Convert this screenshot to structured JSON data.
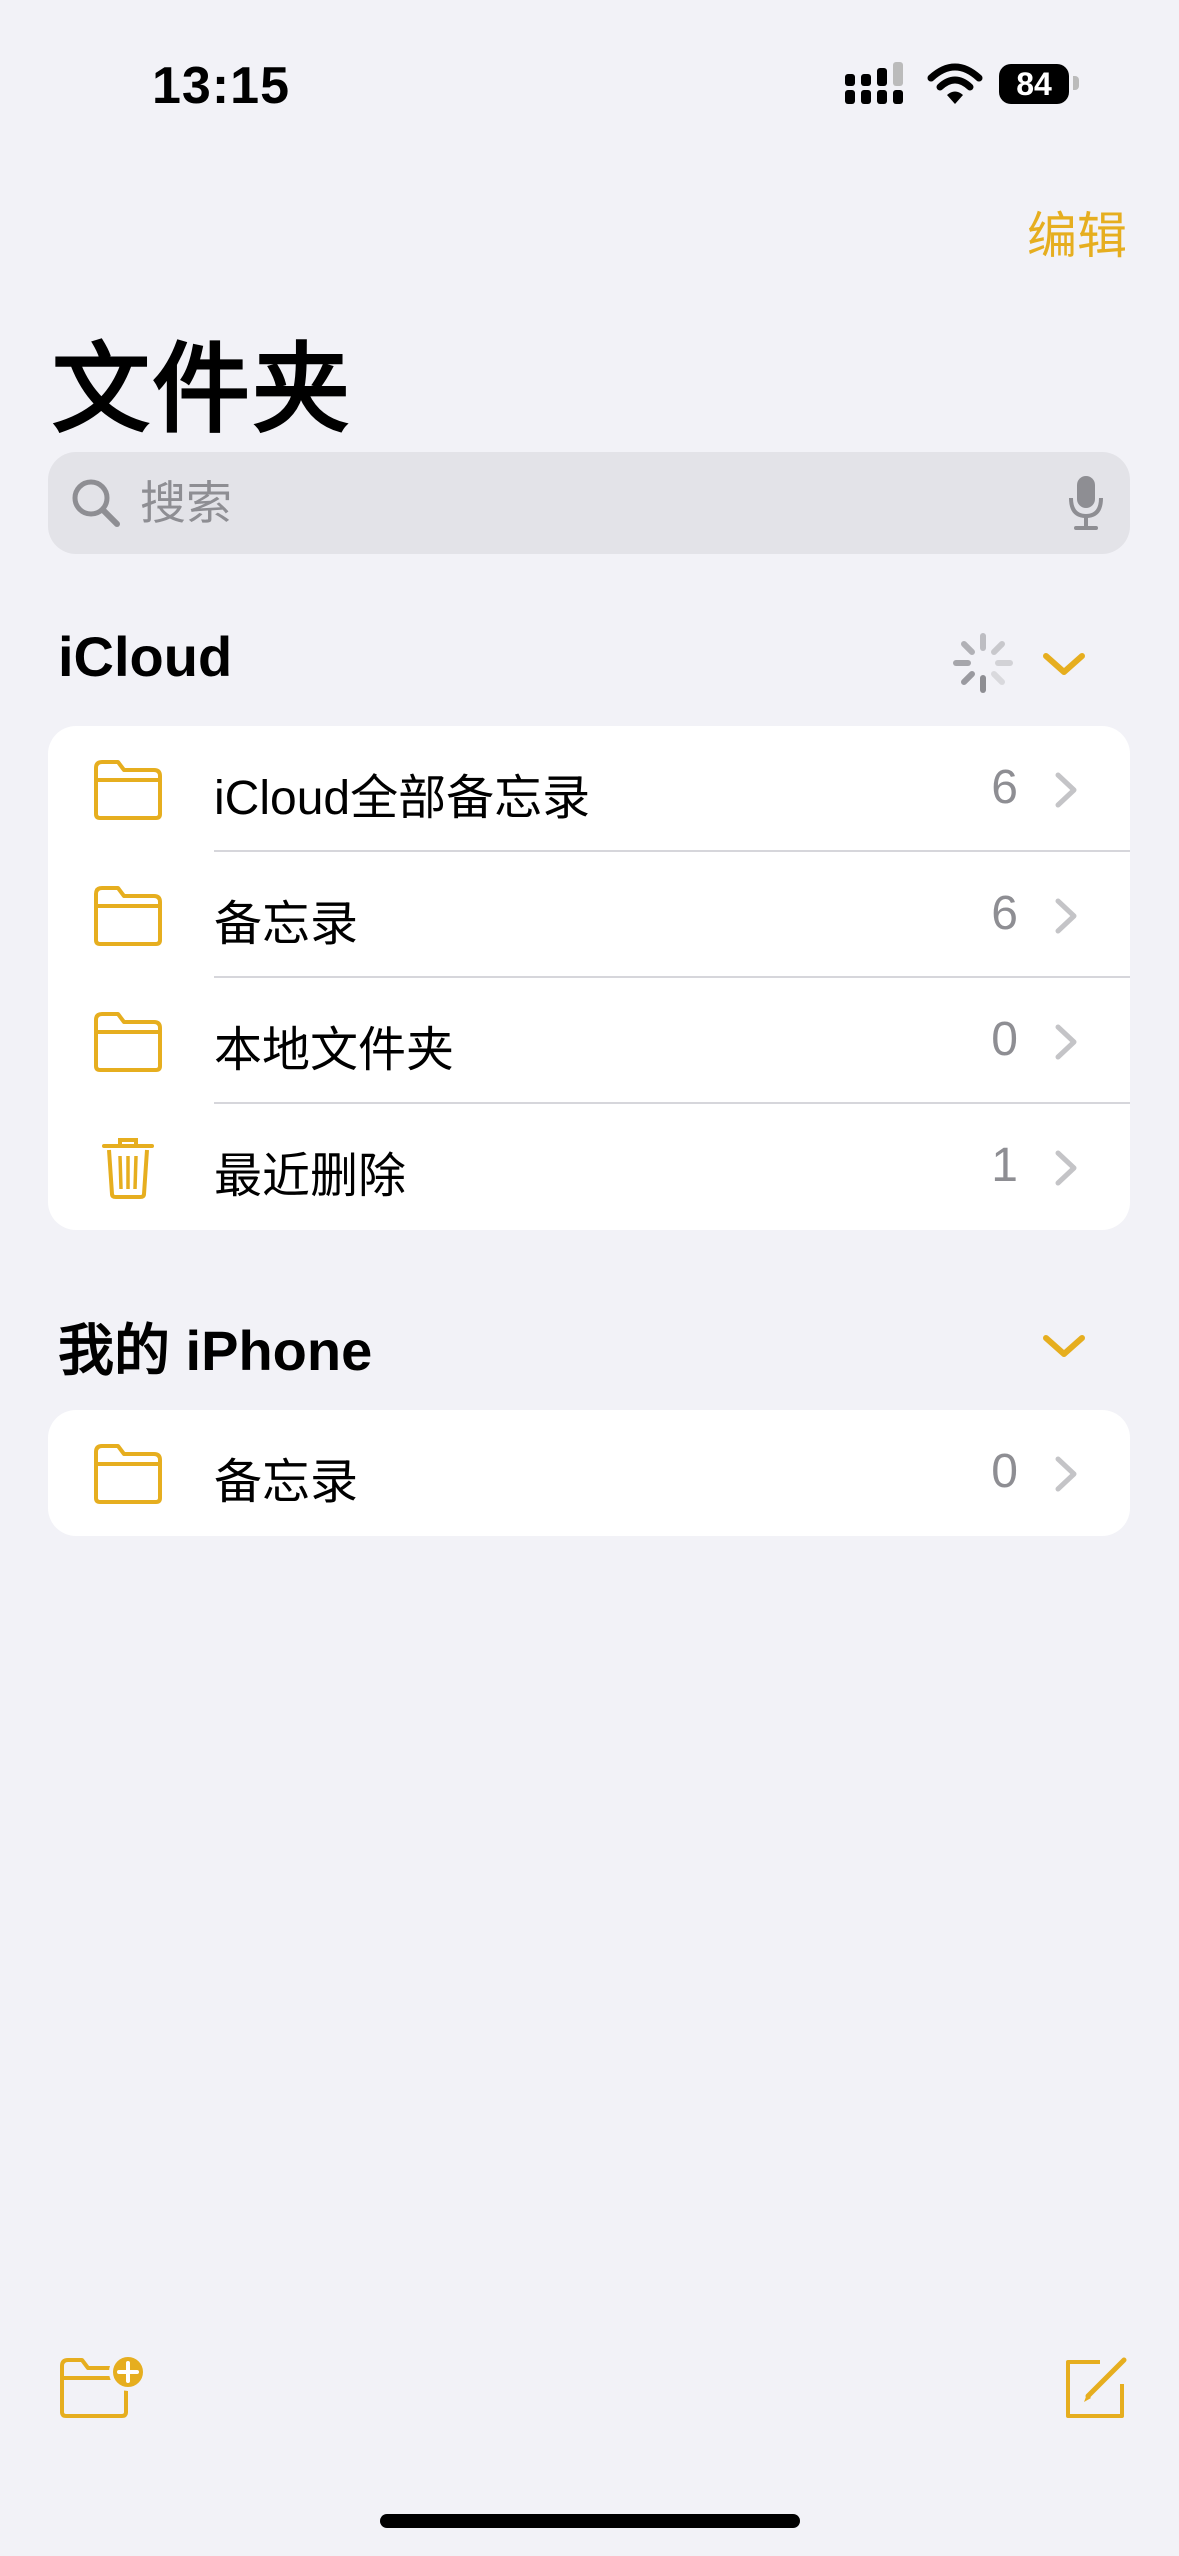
{
  "status_bar": {
    "time": "13:15",
    "battery": "84"
  },
  "nav": {
    "edit_label": "编辑",
    "title": "文件夹"
  },
  "search": {
    "placeholder": "搜索"
  },
  "accent_color": "#E6AE1F",
  "sections": [
    {
      "title": "iCloud",
      "loading": true,
      "items": [
        {
          "icon": "folder-icon",
          "label": "iCloud全部备忘录",
          "count": "6"
        },
        {
          "icon": "folder-icon",
          "label": "备忘录",
          "count": "6"
        },
        {
          "icon": "folder-icon",
          "label": "本地文件夹",
          "count": "0"
        },
        {
          "icon": "trash-icon",
          "label": "最近删除",
          "count": "1"
        }
      ]
    },
    {
      "title": "我的 iPhone",
      "items": [
        {
          "icon": "folder-icon",
          "label": "备忘录",
          "count": "0"
        }
      ]
    }
  ],
  "toolbar": {
    "left_icon": "new-folder-icon",
    "right_icon": "compose-icon"
  }
}
